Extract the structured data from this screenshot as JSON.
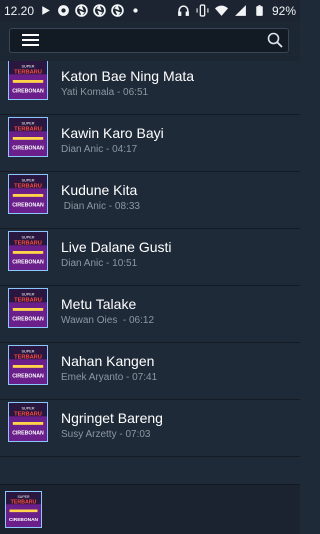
{
  "status_bar": {
    "time": "12.20",
    "battery": "92%",
    "left_icons": [
      "play-store-icon",
      "notification-icon",
      "shutter-icon",
      "shutter-icon",
      "shutter-icon",
      "dot-icon"
    ],
    "right_icons": [
      "headphones-icon",
      "vibrate-icon",
      "wifi-icon",
      "signal-icon",
      "battery-icon"
    ]
  },
  "toolbar": {
    "menu_icon": "hamburger-menu-icon",
    "search_icon": "search-icon"
  },
  "songs": [
    {
      "title": "Katon Bae Ning Mata",
      "artist_duration": "Yati Komala - 06:51"
    },
    {
      "title": "Kawin Karo Bayi",
      "artist_duration": "Dian Anic - 04:17"
    },
    {
      "title": "Kudune Kita",
      "artist_duration": " Dian Anic - 08:33"
    },
    {
      "title": "Live Dalane Gusti",
      "artist_duration": "Dian Anic - 10:51"
    },
    {
      "title": "Metu Talake",
      "artist_duration": "Wawan Oies  - 06:12"
    },
    {
      "title": "Nahan Kangen",
      "artist_duration": "Emek Aryanto - 07:41"
    },
    {
      "title": "Ngringet Bareng",
      "artist_duration": "Susy Arzetty - 07:03"
    }
  ],
  "thumbnail": {
    "line1": "SUPER",
    "line2": "TERBARU",
    "line3": "CIREBONAN"
  },
  "colors": {
    "background": "#1f2a38",
    "thumb_border": "#8cc6ff",
    "thumb_fill": "#5a1d7a",
    "meta_text": "#8d97a3"
  }
}
